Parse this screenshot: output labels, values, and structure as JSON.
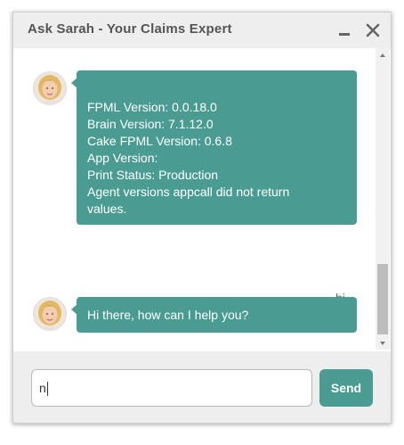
{
  "window": {
    "title": "Ask Sarah - Your Claims Expert",
    "minimize_icon": "minimize-icon",
    "close_icon": "close-icon"
  },
  "messages": [
    {
      "from": "agent",
      "lines": [
        "",
        "FPML Version: 0.0.18.0",
        "Brain Version: 7.1.12.0",
        "Cake FPML Version: 0.6.8",
        "App Version:",
        "Print Status: Production",
        "Agent versions appcall did not return",
        "values."
      ]
    },
    {
      "from": "user",
      "text": "hi"
    },
    {
      "from": "agent",
      "lines": [
        "Hi there, how can I help you?"
      ]
    }
  ],
  "composer": {
    "input_value": "n",
    "send_label": "Send"
  },
  "colors": {
    "accent": "#4a9b92",
    "titlebar": "#eeeeee",
    "title_text": "#555555"
  }
}
